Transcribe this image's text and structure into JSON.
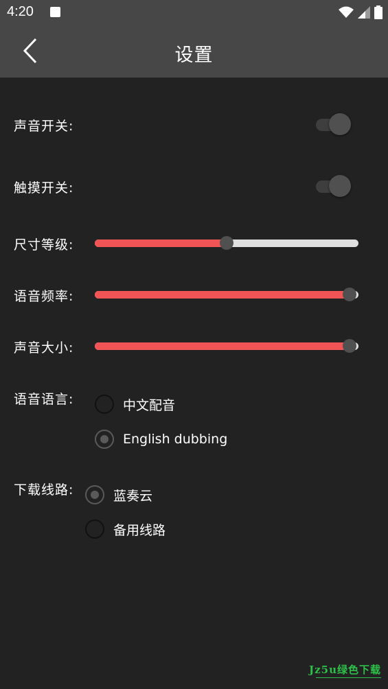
{
  "status_bar": {
    "time": "4:20"
  },
  "header": {
    "title": "设置"
  },
  "settings": {
    "sound_switch": {
      "label": "声音开关:",
      "on": false
    },
    "touch_switch": {
      "label": "触摸开关:",
      "on": false
    },
    "size_level": {
      "label": "尺寸等级:",
      "value_fraction": 0.5
    },
    "voice_rate": {
      "label": "语音频率:",
      "value_fraction": 0.965
    },
    "volume": {
      "label": "声音大小:",
      "value_fraction": 0.965
    },
    "voice_language": {
      "label": "语音语言:",
      "options": [
        {
          "label": "中文配音",
          "selected": false
        },
        {
          "label": "English dubbing",
          "selected": true
        }
      ]
    },
    "download_route": {
      "label": "下载线路:",
      "options": [
        {
          "label": "蓝奏云",
          "selected": true
        },
        {
          "label": "备用线路",
          "selected": false
        }
      ]
    }
  },
  "watermark": {
    "text": "Jz5u绿色下载"
  },
  "colors": {
    "accent": "#f05454",
    "toolbar": "#474747",
    "background": "#222222"
  }
}
